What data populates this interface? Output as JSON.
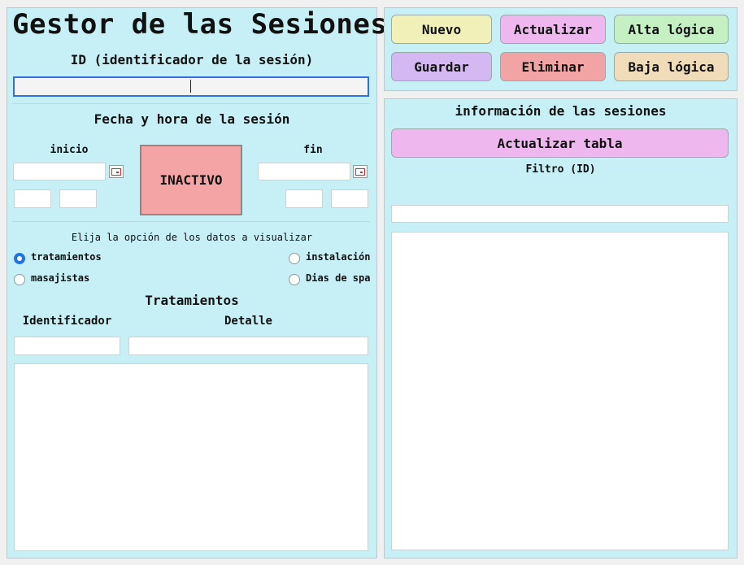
{
  "left": {
    "title": "Gestor de las Sesiones",
    "id_label": "ID (identificador de la sesión)",
    "id_value": "",
    "datetime_heading": "Fecha y hora de la sesión",
    "start_label": "inicio",
    "end_label": "fin",
    "status_button": "INACTIVO",
    "choose_text": "Elija la opción de los datos a visualizar",
    "options": {
      "tratamientos": "tratamientos",
      "instalacion": "instalación",
      "masajistas": "masajistas",
      "dias_spa": "Dias de spa"
    },
    "selected_option": "tratamientos",
    "section_title": "Tratamientos",
    "col_identificador": "Identificador",
    "col_detalle": "Detalle"
  },
  "toolbar": {
    "nuevo": "Nuevo",
    "actualizar": "Actualizar",
    "alta": "Alta lógica",
    "guardar": "Guardar",
    "eliminar": "Eliminar",
    "baja": "Baja lógica"
  },
  "right": {
    "heading": "información de las sesiones",
    "refresh_button": "Actualizar tabla",
    "filter_label": "Filtro (ID)",
    "filter_value": ""
  },
  "colors": {
    "panel": "#c6f0f6",
    "nuevo": "#f0f0b8",
    "actualizar": "#eeb8ee",
    "alta": "#c4f0c4",
    "guardar": "#d4b8f2",
    "eliminar": "#f2a4a4",
    "baja": "#f0dcb8",
    "inactivo": "#f4a4a4"
  }
}
